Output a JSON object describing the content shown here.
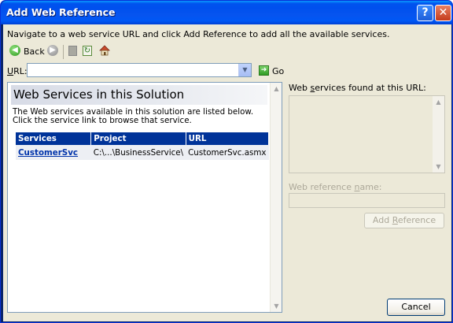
{
  "window": {
    "title": "Add Web Reference",
    "help_button": "?",
    "close_button": "✕"
  },
  "instructions": "Navigate to a web service URL and click Add Reference to add all the available services.",
  "toolbar": {
    "back_label": "Back"
  },
  "url": {
    "label": "URL:",
    "value": "",
    "go_label": "Go"
  },
  "browser": {
    "title": "Web Services in this Solution",
    "description": "The Web services available in this solution are listed below. Click the service link to browse that service.",
    "columns": [
      "Services",
      "Project",
      "URL"
    ],
    "rows": [
      {
        "service": "CustomerSvc",
        "project": "C:\\...\\BusinessService\\",
        "url": "CustomerSvc.asmx"
      }
    ]
  },
  "right_panel": {
    "found_label": "Web services found at this URL:",
    "reference_name_label": "Web reference name:",
    "reference_name_value": "",
    "add_reference_label": "Add Reference"
  },
  "footer": {
    "cancel_label": "Cancel"
  }
}
